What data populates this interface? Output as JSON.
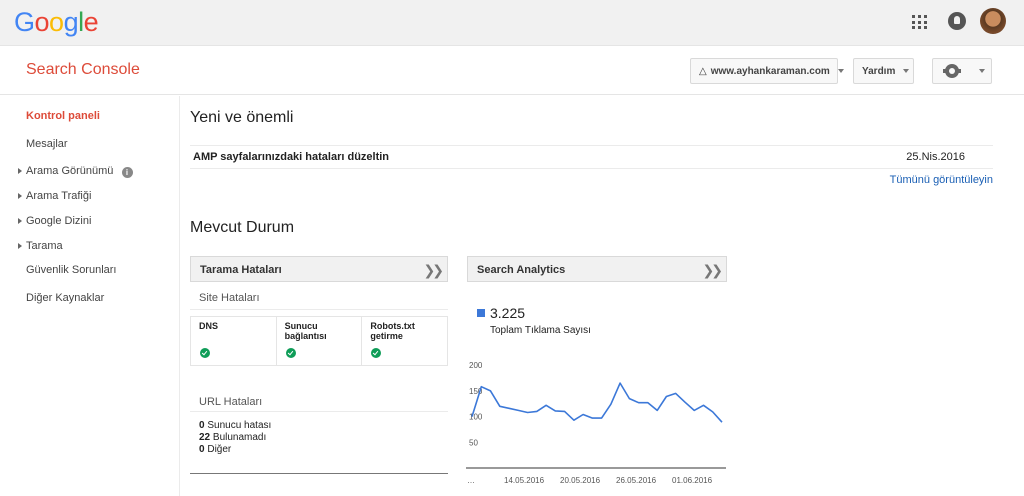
{
  "google_bar": {
    "logo": [
      "G",
      "o",
      "o",
      "g",
      "l",
      "e"
    ],
    "logo_colors": [
      "#4285f4",
      "#ea4335",
      "#fbbc05",
      "#4285f4",
      "#34a853",
      "#ea4335"
    ]
  },
  "header": {
    "title": "Search Console",
    "site": "www.ayhankaraman.com",
    "help": "Yardım"
  },
  "sidebar": {
    "items": [
      {
        "label": "Kontrol paneli"
      },
      {
        "label": "Mesajlar"
      },
      {
        "label": "Arama Görünümü"
      },
      {
        "label": "Arama Trafiği"
      },
      {
        "label": "Google Dizini"
      },
      {
        "label": "Tarama"
      },
      {
        "label": "Güvenlik Sorunları"
      },
      {
        "label": "Diğer Kaynaklar"
      }
    ],
    "info_icon": "i"
  },
  "main": {
    "new_title": "Yeni ve önemli",
    "message": "AMP sayfalarınızdaki hataları düzeltin",
    "message_date": "25.Nis.2016",
    "view_all": "Tümünü görüntüleyin",
    "status_title": "Mevcut Durum"
  },
  "crawl_card": {
    "title": "Tarama Hataları",
    "site_errors": "Site Hataları",
    "cols": [
      "DNS",
      "Sunucu bağlantısı",
      "Robots.txt getirme"
    ],
    "url_errors": "URL Hataları",
    "url_items": [
      {
        "count": "0",
        "label": "Sunucu hatası"
      },
      {
        "count": "22",
        "label": "Bulunamadı"
      },
      {
        "count": "0",
        "label": "Diğer"
      }
    ]
  },
  "analytics_card": {
    "title": "Search Analytics",
    "value": "3.225",
    "label": "Toplam Tıklama Sayısı",
    "series_color": "#3c78d8"
  },
  "chart_data": {
    "type": "line",
    "series": [
      {
        "name": "Toplam Tıklama Sayısı",
        "values": [
          100,
          158,
          150,
          120,
          116,
          112,
          108,
          110,
          122,
          111,
          110,
          93,
          104,
          97,
          97,
          124,
          165,
          135,
          127,
          127,
          112,
          139,
          145,
          128,
          112,
          122,
          109,
          89
        ]
      }
    ],
    "y_ticks": [
      "200",
      "150",
      "100",
      "50"
    ],
    "ylim": [
      0,
      210
    ],
    "x_ticks": [
      "…",
      "14.05.2016",
      "20.05.2016",
      "26.05.2016",
      "01.06.2016"
    ],
    "grid": false
  }
}
